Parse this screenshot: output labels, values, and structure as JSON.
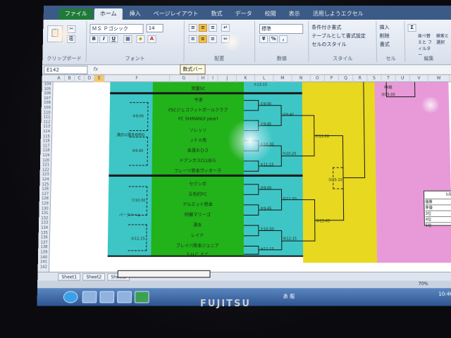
{
  "ribbon": {
    "tabs": [
      "ファイル",
      "ホーム",
      "挿入",
      "ページレイアウト",
      "数式",
      "データ",
      "校閲",
      "表示",
      "活用しようエクセル"
    ],
    "font_name": "ＭＳ Ｐゴシック",
    "font_size": "14",
    "number_format": "標準",
    "groups": [
      "クリップボード",
      "フォント",
      "配置",
      "数値",
      "スタイル",
      "セル",
      "編集"
    ],
    "style_items": [
      "条件付き書式",
      "テーブルとして書式設定",
      "セルのスタイル"
    ],
    "cell_items": [
      "挿入",
      "削除",
      "書式"
    ],
    "edit_items": [
      "並べ替えと フィルター",
      "検索と 選択"
    ]
  },
  "formula_bar": {
    "name_box": "E142",
    "fx": "fx",
    "tooltip": "数式バー"
  },
  "columns": [
    "A",
    "B",
    "C",
    "D",
    "E",
    "F",
    "G",
    "H",
    "I",
    "J",
    "K",
    "L",
    "M",
    "N",
    "O",
    "P",
    "Q",
    "R",
    "S",
    "T",
    "U",
    "V",
    "W"
  ],
  "rows": [
    "104",
    "105",
    "106",
    "107",
    "108",
    "109",
    "110",
    "111",
    "112",
    "113",
    "114",
    "115",
    "116",
    "117",
    "118",
    "119",
    "120",
    "121",
    "122",
    "123",
    "124",
    "125",
    "126",
    "127",
    "128",
    "129",
    "130",
    "131",
    "132",
    "133",
    "134",
    "135",
    "136",
    "137",
    "138",
    "139",
    "140",
    "141",
    "142"
  ],
  "bracket": {
    "top_teams": [
      "",
      "常盤SC"
    ],
    "group1_label": "諏訪公園多目的G",
    "group1_teams": [
      "今津",
      "FSCジェコフットボールクラブ",
      "FC SHIRANUI pearl",
      "ソレッソ",
      "ＪＦＡ熊",
      "本渡おひさ",
      "ドアンガスCLUBら",
      "フレーツ熊本ヴィオーラ"
    ],
    "group2_label": "パークドーム",
    "group2_teams": [
      "セクシボ",
      "五色町FC",
      "アルエット熊本",
      "阿蘇マリーゴ",
      "清水",
      "レイド",
      "ブレイバ熊本ジュニア",
      "ＳＨＣ ＦＣ"
    ],
    "seeds_left": [
      "⑨9:00",
      "⑩9:45",
      "⑪10:30",
      "⑫11:15"
    ],
    "match_times": [
      "①9:00",
      "②9:45",
      "③10:30",
      "④11:15",
      "⑤9:00",
      "⑥9:45",
      "⑦10:30",
      "⑧11:15"
    ],
    "round2_times": [
      "⑬9:40",
      "⑭10:25",
      "⑮11:30",
      "⑯12:15"
    ],
    "round3_times": [
      "⑰13:00",
      "⑱13:45"
    ],
    "semi_time": "⑲15:15",
    "final_label": "PK戦",
    "final_time": "⑳15:00",
    "top_match": "①13:15"
  },
  "side_table": {
    "header": "5月",
    "rows": [
      "優勝",
      "準優",
      "3位",
      "4位",
      "5位"
    ]
  },
  "sheet_tabs": [
    "Sheet1",
    "Sheet2",
    "Sheet3"
  ],
  "status": {
    "zoom": "70%"
  },
  "taskbar": {
    "ime": "あ 般",
    "clock": "10:46"
  },
  "brand": "FUJITSU",
  "colors": {
    "teal": "#3ec6c6",
    "green": "#22b21a",
    "yellow": "#e8d820",
    "pink": "#e89ad8",
    "ribbon": "#3c5a86"
  }
}
